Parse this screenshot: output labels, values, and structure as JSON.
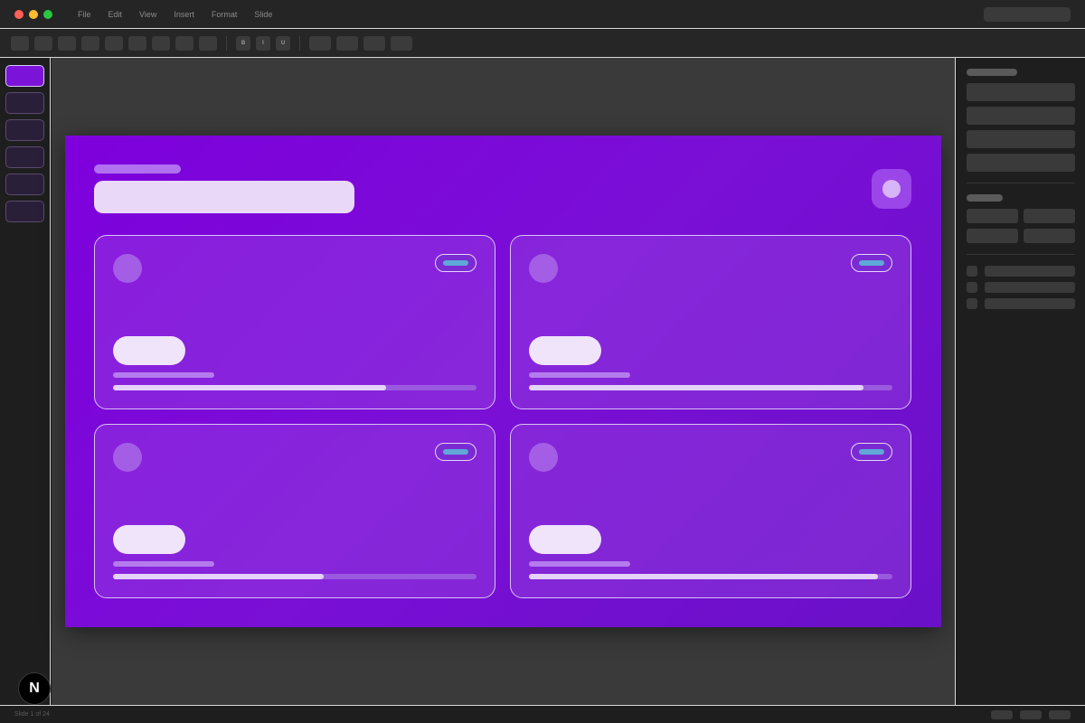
{
  "menu": {
    "items": [
      "File",
      "Edit",
      "View",
      "Insert",
      "Format",
      "Slide"
    ]
  },
  "toolbar": {
    "format_buttons": [
      "B",
      "I",
      "U"
    ]
  },
  "slide": {
    "cards": [
      {
        "progress": 0.75
      },
      {
        "progress": 0.92
      },
      {
        "progress": 0.58
      },
      {
        "progress": 0.96
      }
    ]
  },
  "status": {
    "slide_counter": "Slide 1 of 24"
  },
  "fab": {
    "glyph": "N"
  },
  "colors": {
    "slide_bg": "#7e00dc",
    "accent": "#7b13d8",
    "badge_pill": "#5fa8d8"
  }
}
